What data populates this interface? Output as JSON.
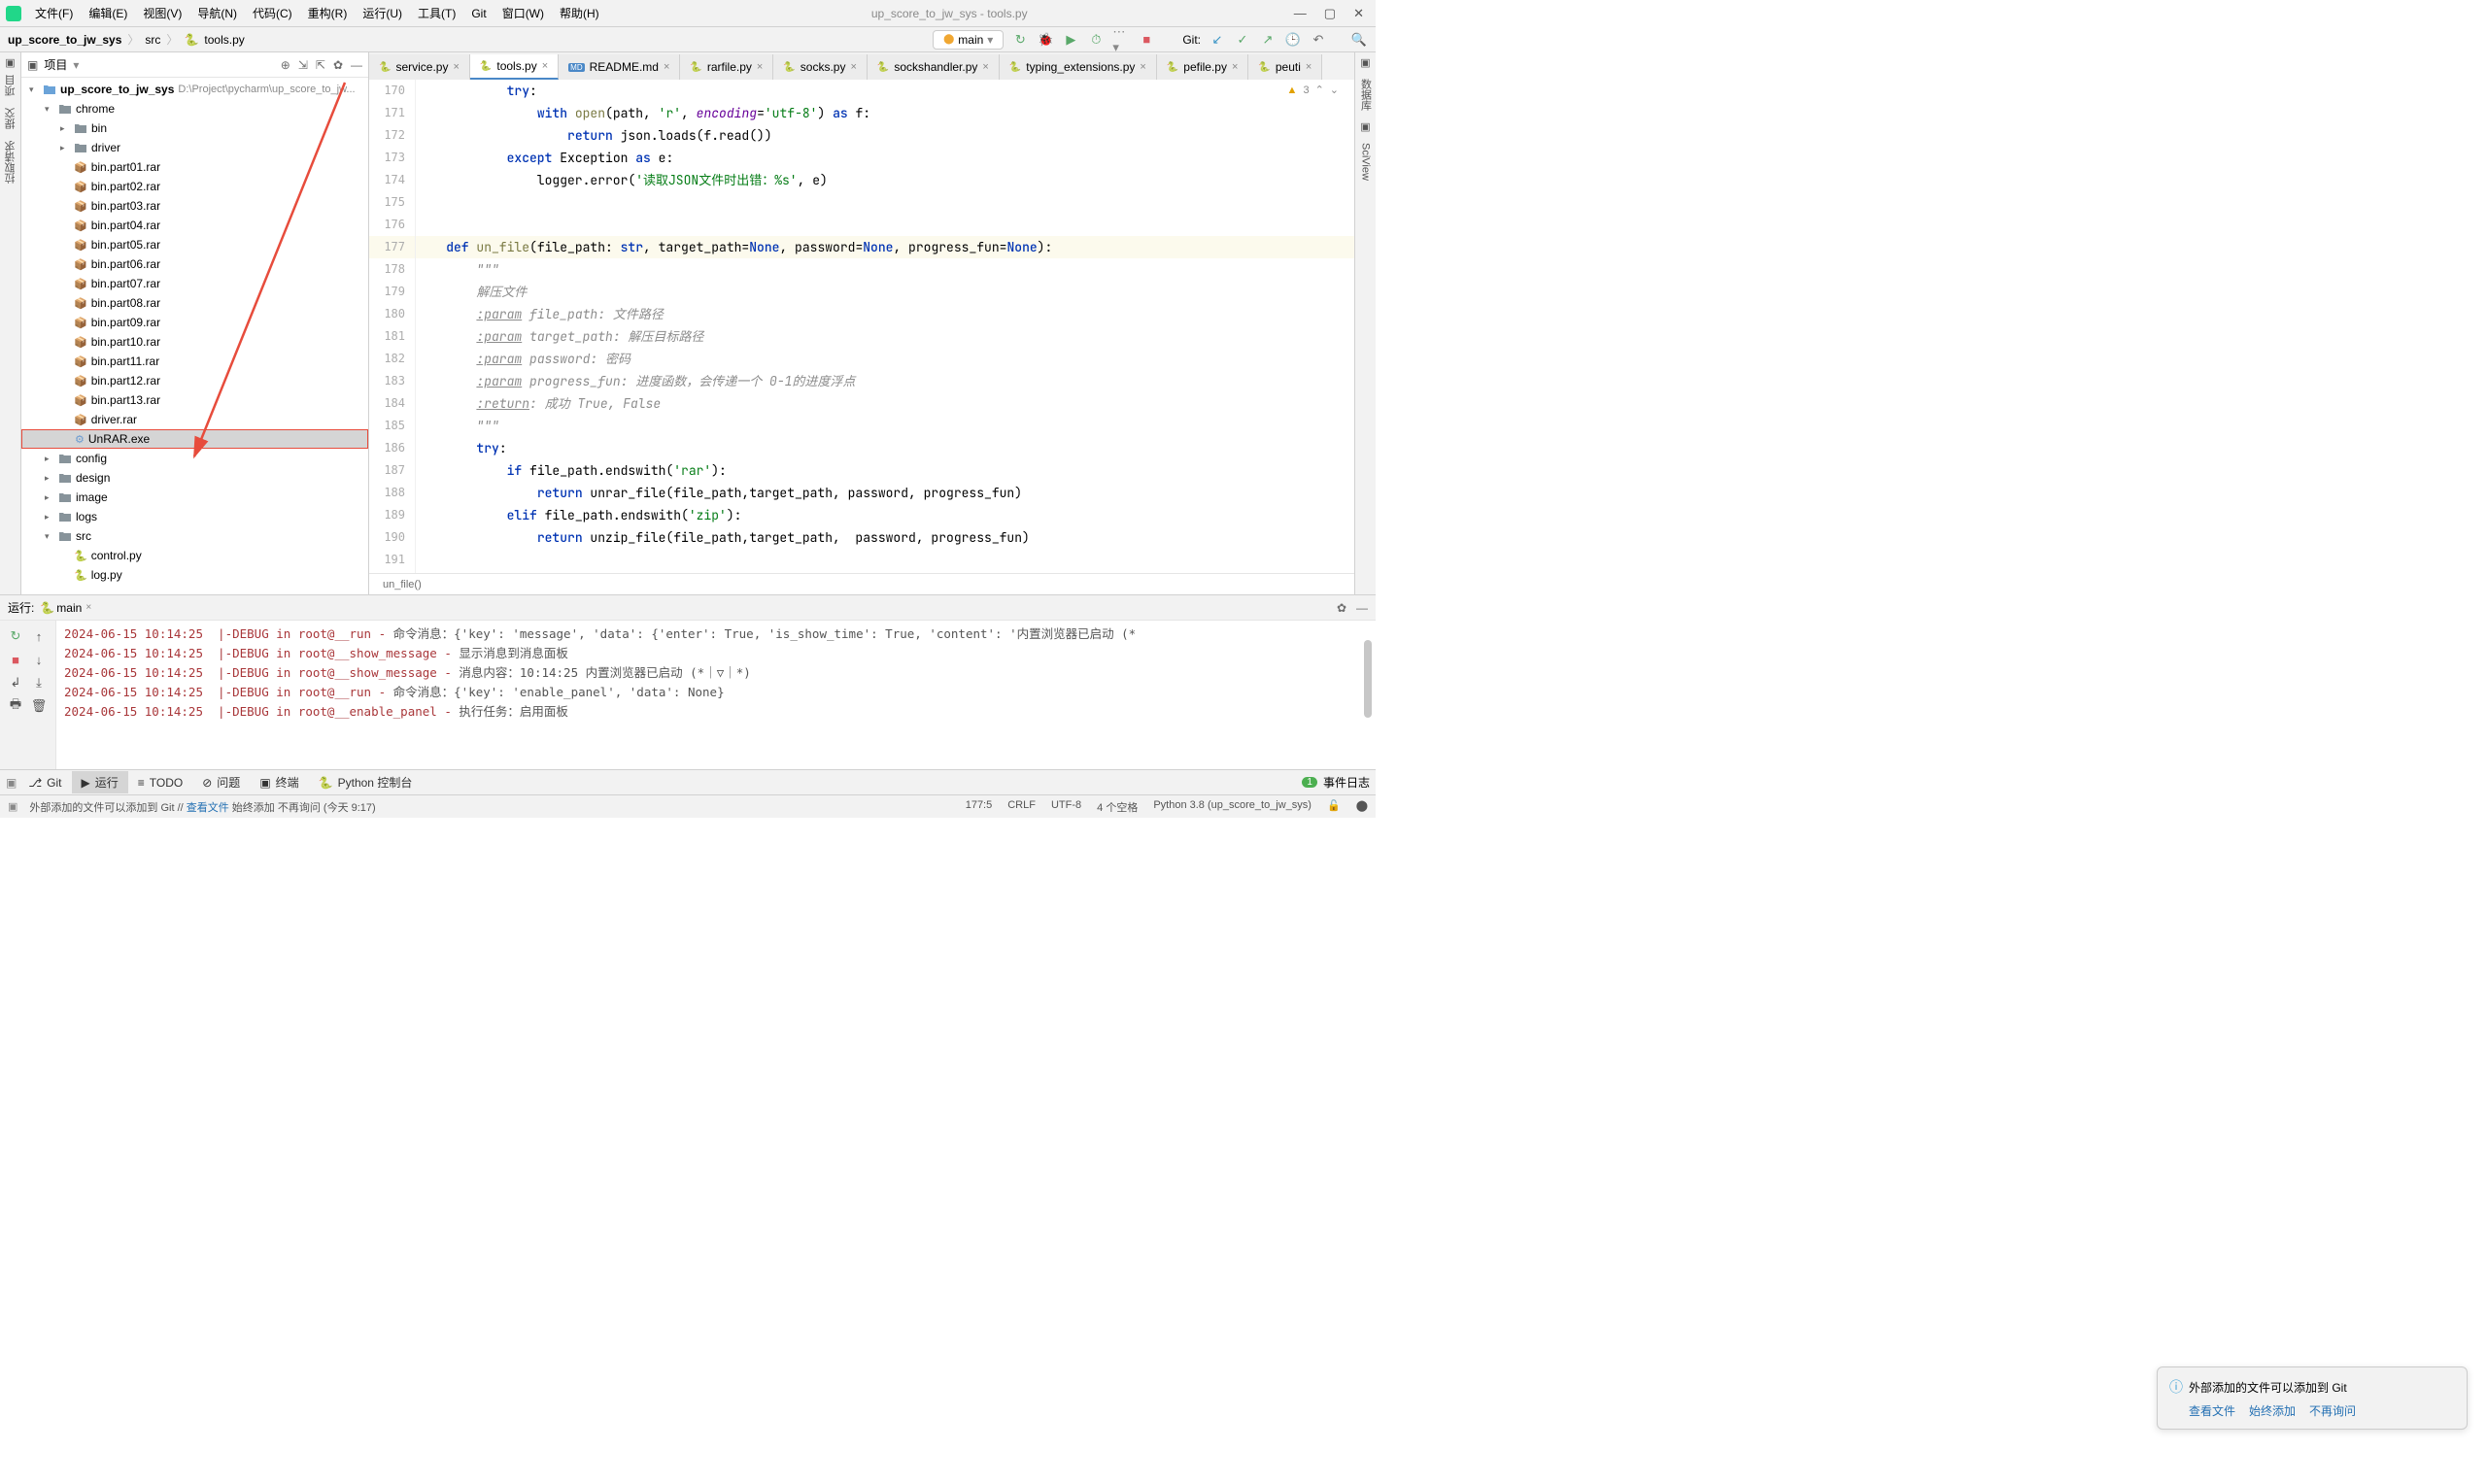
{
  "window": {
    "title": "up_score_to_jw_sys - tools.py"
  },
  "menus": [
    "文件(F)",
    "编辑(E)",
    "视图(V)",
    "导航(N)",
    "代码(C)",
    "重构(R)",
    "运行(U)",
    "工具(T)",
    "Git",
    "窗口(W)",
    "帮助(H)"
  ],
  "breadcrumb": {
    "root": "up_score_to_jw_sys",
    "parts": [
      "src",
      "tools.py"
    ]
  },
  "toolbar": {
    "branch": "main",
    "git_label": "Git:"
  },
  "left_gutter": {
    "label1": "项目",
    "label2": "提交",
    "label3": "拉取请求"
  },
  "right_gutter": {
    "label1": "数据库",
    "label2": "SciView"
  },
  "project_panel": {
    "title": "项目",
    "root": {
      "name": "up_score_to_jw_sys",
      "path": "D:\\Project\\pycharm\\up_score_to_jw..."
    },
    "chrome": "chrome",
    "chrome_children": [
      "bin",
      "driver"
    ],
    "rar_files": [
      "bin.part01.rar",
      "bin.part02.rar",
      "bin.part03.rar",
      "bin.part04.rar",
      "bin.part05.rar",
      "bin.part06.rar",
      "bin.part07.rar",
      "bin.part08.rar",
      "bin.part09.rar",
      "bin.part10.rar",
      "bin.part11.rar",
      "bin.part12.rar",
      "bin.part13.rar",
      "driver.rar"
    ],
    "selected": "UnRAR.exe",
    "folders2": [
      "config",
      "design",
      "image",
      "logs"
    ],
    "src": "src",
    "src_children": [
      "control.py",
      "log.py"
    ]
  },
  "tabs": [
    {
      "name": "service.py",
      "icon": "py",
      "active": false
    },
    {
      "name": "tools.py",
      "icon": "py",
      "active": true
    },
    {
      "name": "README.md",
      "icon": "md",
      "active": false
    },
    {
      "name": "rarfile.py",
      "icon": "py",
      "active": false
    },
    {
      "name": "socks.py",
      "icon": "py",
      "active": false
    },
    {
      "name": "sockshandler.py",
      "icon": "py",
      "active": false
    },
    {
      "name": "typing_extensions.py",
      "icon": "py",
      "active": false
    },
    {
      "name": "pefile.py",
      "icon": "py",
      "active": false
    },
    {
      "name": "peuti",
      "icon": "py",
      "active": false
    }
  ],
  "editor": {
    "warnings": "3",
    "breadcrumb": "un_file()",
    "lines": [
      {
        "n": 170,
        "ind": "            ",
        "parts": [
          {
            "t": "try",
            "c": "kw"
          },
          {
            "t": ":",
            "c": ""
          }
        ]
      },
      {
        "n": 171,
        "ind": "                ",
        "parts": [
          {
            "t": "with ",
            "c": "kw"
          },
          {
            "t": "open",
            "c": "fn"
          },
          {
            "t": "(path, ",
            "c": ""
          },
          {
            "t": "'r'",
            "c": "str"
          },
          {
            "t": ", ",
            "c": ""
          },
          {
            "t": "encoding",
            "c": "param"
          },
          {
            "t": "=",
            "c": ""
          },
          {
            "t": "'utf-8'",
            "c": "str"
          },
          {
            "t": ") ",
            "c": ""
          },
          {
            "t": "as ",
            "c": "kw"
          },
          {
            "t": "f:",
            "c": ""
          }
        ]
      },
      {
        "n": 172,
        "ind": "                    ",
        "parts": [
          {
            "t": "return ",
            "c": "kw"
          },
          {
            "t": "json.loads(f.read())",
            "c": ""
          }
        ]
      },
      {
        "n": 173,
        "ind": "            ",
        "parts": [
          {
            "t": "except ",
            "c": "kw"
          },
          {
            "t": "Exception ",
            "c": ""
          },
          {
            "t": "as ",
            "c": "kw"
          },
          {
            "t": "e:",
            "c": ""
          }
        ]
      },
      {
        "n": 174,
        "ind": "                ",
        "parts": [
          {
            "t": "logger.error(",
            "c": ""
          },
          {
            "t": "'读取JSON文件时出错：%s'",
            "c": "str"
          },
          {
            "t": ", e)",
            "c": ""
          }
        ]
      },
      {
        "n": 175,
        "ind": "",
        "parts": []
      },
      {
        "n": 176,
        "ind": "",
        "parts": []
      },
      {
        "n": 177,
        "ind": "    ",
        "hl": true,
        "parts": [
          {
            "t": "def ",
            "c": "kw"
          },
          {
            "t": "un_file",
            "c": "fn"
          },
          {
            "t": "(file_path: ",
            "c": ""
          },
          {
            "t": "str",
            "c": "kw"
          },
          {
            "t": ", target_path=",
            "c": ""
          },
          {
            "t": "None",
            "c": "kw"
          },
          {
            "t": ", password=",
            "c": ""
          },
          {
            "t": "None",
            "c": "kw"
          },
          {
            "t": ", progress_fun=",
            "c": ""
          },
          {
            "t": "None",
            "c": "kw"
          },
          {
            "t": "):",
            "c": ""
          }
        ]
      },
      {
        "n": 178,
        "ind": "        ",
        "parts": [
          {
            "t": "\"\"\"",
            "c": "comm"
          }
        ]
      },
      {
        "n": 179,
        "ind": "        ",
        "parts": [
          {
            "t": "解压文件",
            "c": "comm"
          }
        ]
      },
      {
        "n": 180,
        "ind": "        ",
        "parts": [
          {
            "t": ":param",
            "c": "doctag"
          },
          {
            "t": " file_path: 文件路径",
            "c": "comm"
          }
        ]
      },
      {
        "n": 181,
        "ind": "        ",
        "parts": [
          {
            "t": ":param",
            "c": "doctag"
          },
          {
            "t": " target_path: 解压目标路径",
            "c": "comm"
          }
        ]
      },
      {
        "n": 182,
        "ind": "        ",
        "parts": [
          {
            "t": ":param",
            "c": "doctag"
          },
          {
            "t": " password: 密码",
            "c": "comm"
          }
        ]
      },
      {
        "n": 183,
        "ind": "        ",
        "parts": [
          {
            "t": ":param",
            "c": "doctag"
          },
          {
            "t": " progress_fun: 进度函数，会传递一个 0-1的进度浮点",
            "c": "comm"
          }
        ]
      },
      {
        "n": 184,
        "ind": "        ",
        "parts": [
          {
            "t": ":return",
            "c": "doctag"
          },
          {
            "t": ": 成功 True, False",
            "c": "comm"
          }
        ]
      },
      {
        "n": 185,
        "ind": "        ",
        "parts": [
          {
            "t": "\"\"\"",
            "c": "comm"
          }
        ]
      },
      {
        "n": 186,
        "ind": "        ",
        "parts": [
          {
            "t": "try",
            "c": "kw"
          },
          {
            "t": ":",
            "c": ""
          }
        ]
      },
      {
        "n": 187,
        "ind": "            ",
        "parts": [
          {
            "t": "if ",
            "c": "kw"
          },
          {
            "t": "file_path.endswith(",
            "c": ""
          },
          {
            "t": "'rar'",
            "c": "str"
          },
          {
            "t": "):",
            "c": ""
          }
        ]
      },
      {
        "n": 188,
        "ind": "                ",
        "parts": [
          {
            "t": "return ",
            "c": "kw"
          },
          {
            "t": "unrar_file(file_path,target_path, password, progress_fun)",
            "c": ""
          }
        ]
      },
      {
        "n": 189,
        "ind": "            ",
        "parts": [
          {
            "t": "elif ",
            "c": "kw"
          },
          {
            "t": "file_path.endswith(",
            "c": ""
          },
          {
            "t": "'zip'",
            "c": "str"
          },
          {
            "t": "):",
            "c": ""
          }
        ]
      },
      {
        "n": 190,
        "ind": "                ",
        "parts": [
          {
            "t": "return ",
            "c": "kw"
          },
          {
            "t": "unzip_file(file_path,target_path,  password, progress_fun)",
            "c": ""
          }
        ]
      },
      {
        "n": 191,
        "ind": "",
        "parts": []
      }
    ]
  },
  "run": {
    "label": "运行:",
    "config": "main",
    "lines": [
      {
        "pre": "2024-06-15 10:14:25  |-DEBUG in root@__run - ",
        "msg": "命令消息：{'key': 'message', 'data': {'enter': True, 'is_show_time': True, 'content': '内置浏览器已启动 (*"
      },
      {
        "pre": "2024-06-15 10:14:25  |-DEBUG in root@__show_message - ",
        "msg": "显示消息到消息面板"
      },
      {
        "pre": "2024-06-15 10:14:25  |-DEBUG in root@__show_message - ",
        "msg": "消息内容：10:14:25 内置浏览器已启动 (*｜▽｜*)"
      },
      {
        "pre": "",
        "msg": ""
      },
      {
        "pre": "2024-06-15 10:14:25  |-DEBUG in root@__run - ",
        "msg": "命令消息：{'key': 'enable_panel', 'data': None}"
      },
      {
        "pre": "2024-06-15 10:14:25  |-DEBUG in root@__enable_panel - ",
        "msg": "执行任务：启用面板"
      }
    ]
  },
  "git_popup": {
    "title": "外部添加的文件可以添加到 Git",
    "links": [
      "查看文件",
      "始终添加",
      "不再询问"
    ]
  },
  "tool_strip": {
    "items": [
      {
        "label": "Git",
        "icon": "⎇"
      },
      {
        "label": "运行",
        "icon": "▶",
        "active": true
      },
      {
        "label": "TODO",
        "icon": "≡"
      },
      {
        "label": "问题",
        "icon": "⊘"
      },
      {
        "label": "终端",
        "icon": "▣"
      },
      {
        "label": "Python 控制台",
        "icon": "🐍"
      }
    ],
    "events_label": "事件日志",
    "events_count": "1"
  },
  "statusbar": {
    "left": "外部添加的文件可以添加到 Git // 查看文件   始终添加   不再询问 (今天 9:17)",
    "left_prefix": "外部添加的文件可以添加到 Git // ",
    "left_link": "查看文件",
    "left_rest": "   始终添加   不再询问 (今天 9:17)",
    "pos": "177:5",
    "eol": "CRLF",
    "enc": "UTF-8",
    "indent": "4 个空格",
    "interp": "Python 3.8 (up_score_to_jw_sys)"
  }
}
